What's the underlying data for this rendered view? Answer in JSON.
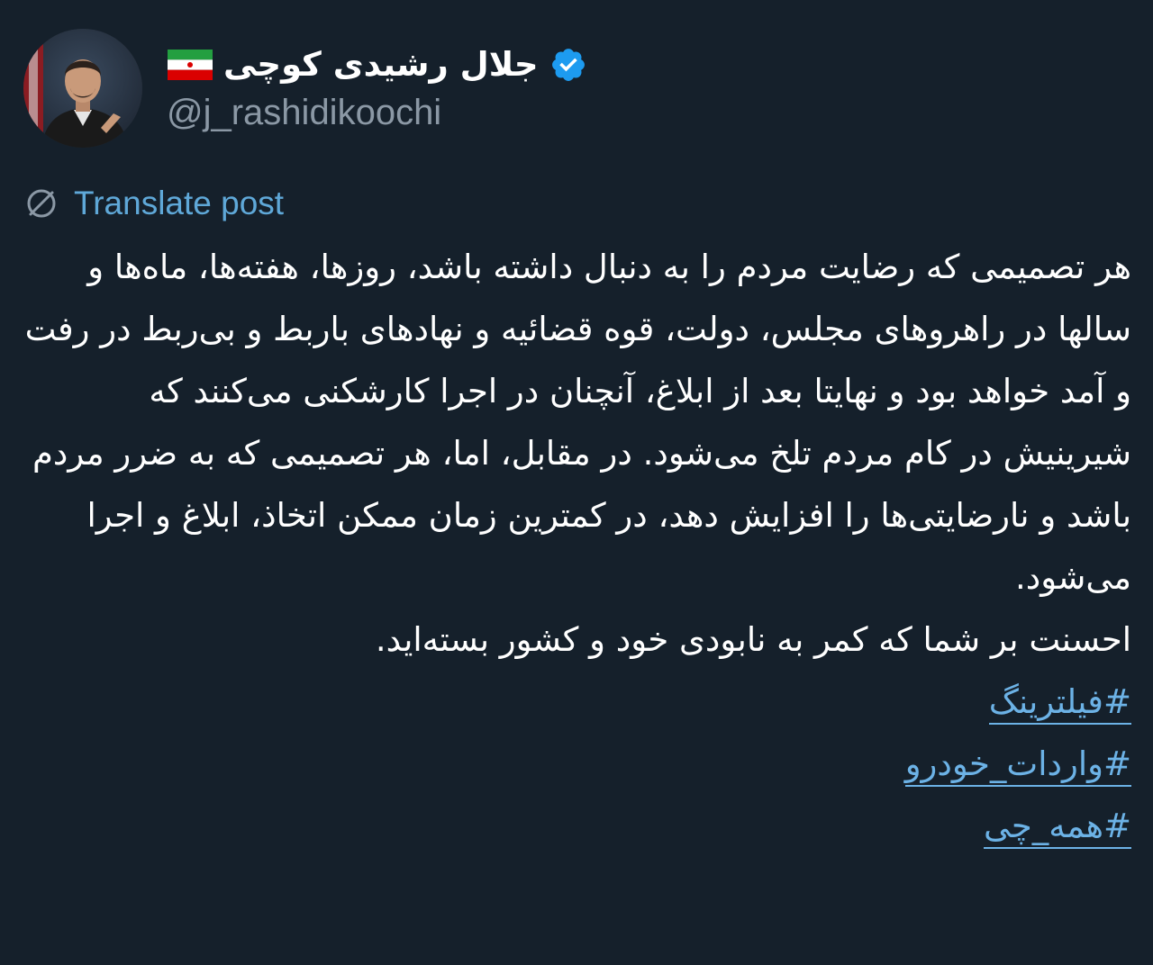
{
  "profile": {
    "display_name": "جلال رشیدی کوچی",
    "handle": "@j_rashidikoochi",
    "avatar_icon": "person-portrait-icon",
    "flag_icon": "iran-flag-icon",
    "verified_icon": "verified-badge-icon"
  },
  "translate": {
    "label": "Translate post",
    "icon": "translate-globe-icon"
  },
  "post": {
    "text": "هر تصمیمی که رضایت مردم را به دنبال داشته باشد، روزها، هفته‌ها، ماه‌ها و سالها در راهروهای مجلس، دولت، قوه قضائیه و نهادهای باربط و بی‌ربط در رفت و آمد خواهد بود و نهایتا بعد از ابلاغ، آنچنان در اجرا کارشکنی می‌کنند که شیرینیش در کام مردم تلخ می‌شود. در مقابل، اما، هر تصمیمی که به ضرر مردم باشد و نارضایتی‌ها را افزایش دهد، در کمترین زمان ممکن اتخاذ، ابلاغ و اجرا می‌شود.\nاحسنت بر شما که کمر به نابودی خود و کشور بسته‌اید.",
    "hashtags": [
      "#فیلترینگ",
      "#واردات_خودرو",
      "#همه_چی"
    ]
  },
  "colors": {
    "background": "#15202b",
    "link": "#6cb2e6",
    "verified": "#1d9bf0",
    "muted": "#8b98a5"
  }
}
